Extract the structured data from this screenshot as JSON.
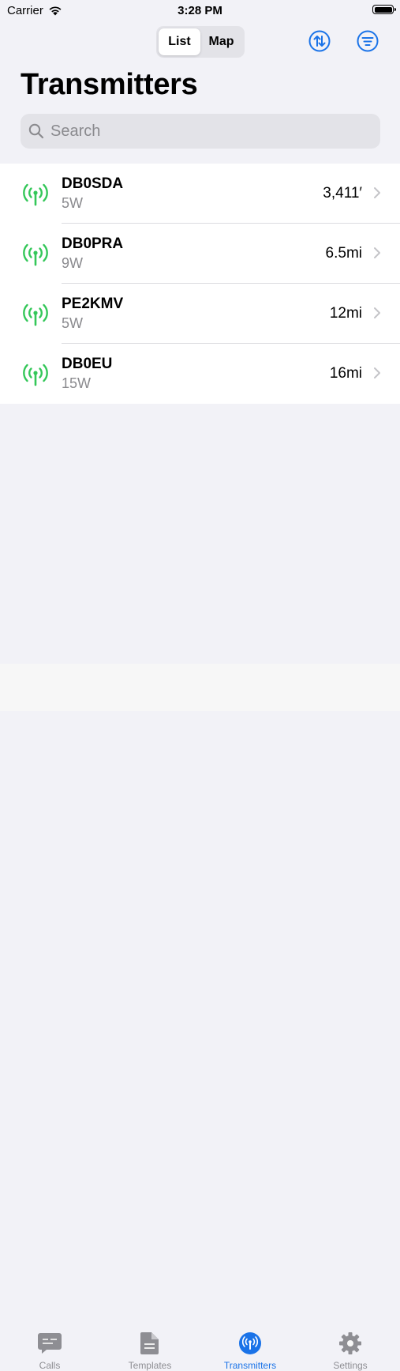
{
  "status_bar": {
    "carrier": "Carrier",
    "time": "3:28 PM"
  },
  "header": {
    "segments": [
      "List",
      "Map"
    ],
    "selected_segment": "List",
    "sort_icon": "sort-arrows-icon",
    "filter_icon": "filter-lines-icon",
    "title": "Transmitters"
  },
  "search": {
    "placeholder": "Search"
  },
  "transmitters": [
    {
      "name": "DB0SDA",
      "power": "5W",
      "distance": "3,411′"
    },
    {
      "name": "DB0PRA",
      "power": "9W",
      "distance": "6.5mi"
    },
    {
      "name": "PE2KMV",
      "power": "5W",
      "distance": "12mi"
    },
    {
      "name": "DB0EU",
      "power": "15W",
      "distance": "16mi"
    }
  ],
  "tabbar": {
    "tabs": [
      {
        "label": "Calls",
        "icon": "message-icon"
      },
      {
        "label": "Templates",
        "icon": "document-icon"
      },
      {
        "label": "Transmitters",
        "icon": "antenna-icon"
      },
      {
        "label": "Settings",
        "icon": "gear-icon"
      }
    ],
    "active": "Transmitters"
  },
  "colors": {
    "accent": "#1a73e8",
    "antenna_green": "#34c759",
    "background": "#f2f2f7"
  }
}
